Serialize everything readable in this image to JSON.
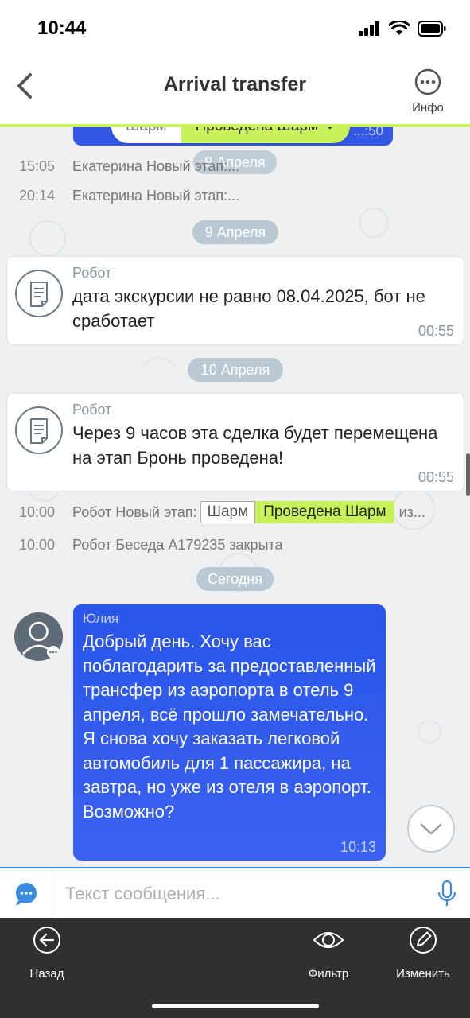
{
  "status": {
    "time": "10:44"
  },
  "nav": {
    "title": "Arrival transfer",
    "info_label": "Инфо"
  },
  "stage_filter": {
    "stage_from": "Шарм",
    "stage_to": "Проведена Шарм"
  },
  "previous_bubble_time": "...:50",
  "events": [
    {
      "date": "8 Апреля"
    },
    {
      "time": "15:05",
      "text": "Екатерина Новый этап:..."
    },
    {
      "time": "20:14",
      "text": "Екатерина Новый этап:..."
    },
    {
      "date": "9 Апреля"
    },
    {
      "author": "Робот",
      "text": "дата экскурсии не равно 08.04.2025, бот не сработает",
      "time": "00:55"
    },
    {
      "date": "10 Апреля"
    },
    {
      "author": "Робот",
      "text": "Через 9 часов эта сделка будет перемещена на этап Бронь проведена!",
      "time": "00:55"
    },
    {
      "time": "10:00",
      "text": "Робот Новый этап:",
      "chip_from": "Шарм",
      "chip_to": "Проведена Шарм",
      "suffix": "из..."
    },
    {
      "time": "10:00",
      "text": "Робот Беседа А179235 закрыта"
    },
    {
      "date": "Сегодня"
    },
    {
      "author": "Юлия",
      "text": "Добрый день. Хочу вас поблагодарить за предоставленный трансфер из аэропорта в отель 9 апреля, всё прошло замечательно. Я снова хочу заказать легковой автомобиль для 1 пассажира, на завтра, но уже из отеля в аэропорт. Возможно?",
      "time": "10:13"
    }
  ],
  "composer": {
    "placeholder": "Текст сообщения..."
  },
  "tabbar": {
    "back": "Назад",
    "filter": "Фильтр",
    "edit": "Изменить"
  },
  "colors": {
    "accent_green": "#c9f25a",
    "bubble_blue": "#3358e6",
    "tabbar_bg": "#2e3032"
  }
}
